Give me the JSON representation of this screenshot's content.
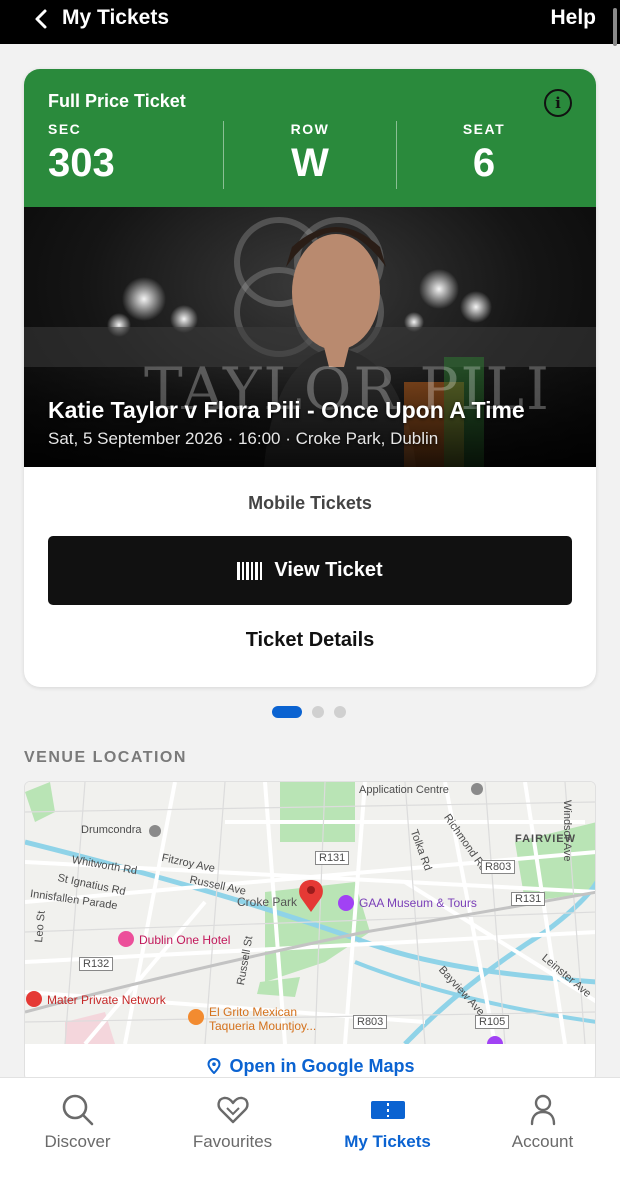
{
  "header": {
    "title": "My Tickets",
    "help_label": "Help"
  },
  "ticket": {
    "type_label": "Full Price Ticket",
    "sec_label": "SEC",
    "sec_value": "303",
    "row_label": "ROW",
    "row_value": "W",
    "seat_label": "SEAT",
    "seat_value": "6",
    "accent_color": "#2a8a3c"
  },
  "event": {
    "poster_text": "TAYLOR PILI",
    "name": "Katie Taylor v Flora Pili - Once Upon A Time",
    "date_line": "Sat, 5 September 2026 · 16:00 · Croke Park, Dublin"
  },
  "actions": {
    "mobile_tickets_label": "Mobile Tickets",
    "view_ticket_label": "View Ticket",
    "ticket_details_label": "Ticket Details"
  },
  "pager": {
    "count": 3,
    "active_index": 0
  },
  "venue": {
    "heading": "VENUE LOCATION",
    "open_maps_label": "Open in Google Maps",
    "map_labels": {
      "application_centre": "Application Centre",
      "windsor_ave": "Windsor Ave",
      "drumcondra": "Drumcondra",
      "richmond_rd": "Richmond Rd",
      "fairview": "FAIRVIEW",
      "tolka_rd": "Tolka Rd",
      "whitworth_rd": "Whitworth Rd",
      "fitzroy_ave": "Fitzroy Ave",
      "r131_a": "R131",
      "r803_a": "R803",
      "st_ignatius_rd": "St Ignatius Rd",
      "russell_ave": "Russell Ave",
      "r131_b": "R131",
      "innisfallen_parade": "Innisfallen Parade",
      "croke_park": "Croke Park",
      "gaa_museum": "GAA Museum & Tours",
      "dublin_one_hotel": "Dublin One Hotel",
      "leo_st": "Leo St",
      "r132": "R132",
      "russell_st": "Russell St",
      "leinster_ave": "Leinster Ave",
      "bayview_ave": "Bayview Ave",
      "mater": "Mater Private Network",
      "el_grito_1": "El Grito Mexican",
      "el_grito_2": "Taqueria Mountjoy...",
      "r803_b": "R803",
      "r105": "R105"
    }
  },
  "tabs": [
    {
      "label": "Discover",
      "icon": "search-icon"
    },
    {
      "label": "Favourites",
      "icon": "heart-icon"
    },
    {
      "label": "My Tickets",
      "icon": "ticket-icon"
    },
    {
      "label": "Account",
      "icon": "person-icon"
    }
  ],
  "colors": {
    "brand_blue": "#0b63d1",
    "map_water": "#8fd3e8",
    "map_park": "#b9e4b5"
  }
}
